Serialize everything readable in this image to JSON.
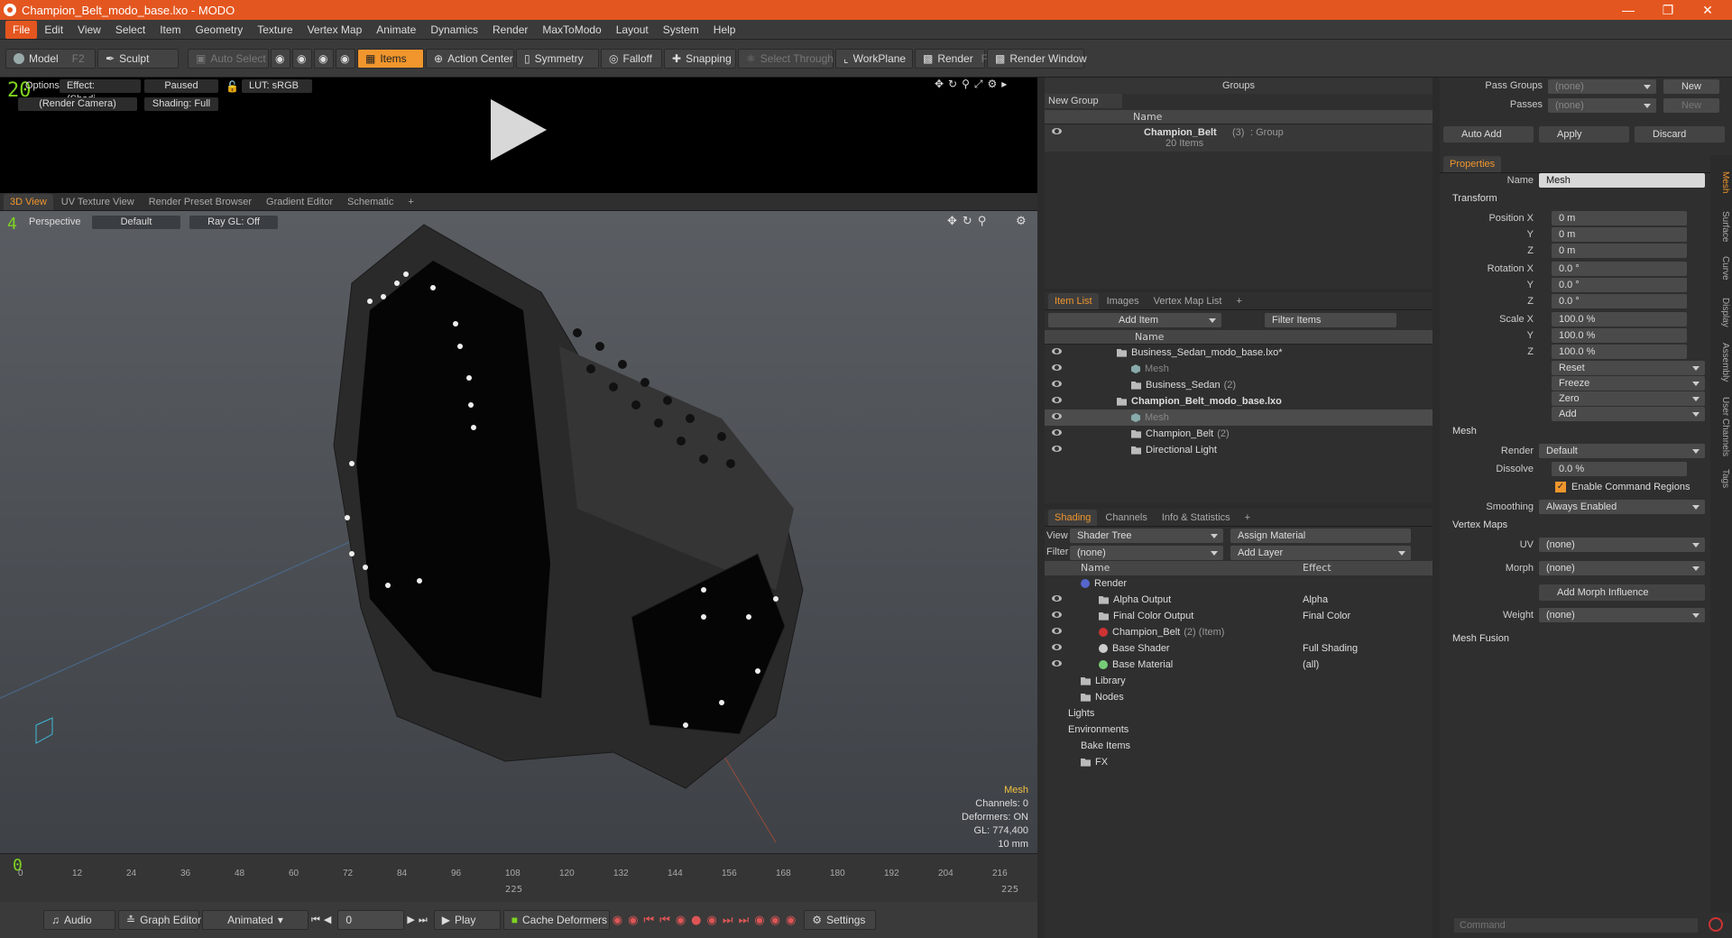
{
  "window": {
    "title": "Champion_Belt_modo_base.lxo - MODO"
  },
  "menus": [
    "File",
    "Edit",
    "View",
    "Select",
    "Item",
    "Geometry",
    "Texture",
    "Vertex Map",
    "Animate",
    "Dynamics",
    "Render",
    "MaxToModo",
    "Layout",
    "System",
    "Help"
  ],
  "toolbar": {
    "model": "Model",
    "model_key": "F2",
    "sculpt": "Sculpt",
    "auto_select": "Auto Select",
    "items": "Items",
    "action_center": "Action Center",
    "symmetry": "Symmetry",
    "falloff": "Falloff",
    "snapping": "Snapping",
    "select_through": "Select Through",
    "workplane": "WorkPlane",
    "render": "Render",
    "render_key": "F9",
    "render_window": "Render Window"
  },
  "preview": {
    "frame": "20",
    "options": "Options",
    "effect": "Effect: (Shadi...",
    "paused": "Paused",
    "lut": "LUT: sRGB",
    "camera": "(Render Camera)",
    "shading": "Shading: Full"
  },
  "view_tabs": [
    "3D View",
    "UV Texture View",
    "Render Preset Browser",
    "Gradient Editor",
    "Schematic",
    "+"
  ],
  "viewport": {
    "view_num": "4",
    "perspective": "Perspective",
    "default": "Default",
    "raygl": "Ray GL: Off",
    "info": {
      "type": "Mesh",
      "channels": "Channels: 0",
      "deformers": "Deformers: ON",
      "gl": "GL: 774,400",
      "scale": "10 mm"
    }
  },
  "timeline": {
    "frame": "0",
    "end": "225",
    "ticks": [
      "0",
      "12",
      "24",
      "36",
      "48",
      "60",
      "72",
      "84",
      "96",
      "108",
      "120",
      "132",
      "144",
      "156",
      "168",
      "180",
      "192",
      "204",
      "216"
    ]
  },
  "bottombar": {
    "audio": "Audio",
    "graph_editor": "Graph Editor",
    "animated": "Animated",
    "frame": "0",
    "play": "Play",
    "cache": "Cache Deformers",
    "settings": "Settings"
  },
  "groups": {
    "title": "Groups",
    "new_group": "New Group",
    "col_name": "Name",
    "group_name": "Champion_Belt",
    "group_count": "(3)",
    "group_type": ": Group",
    "group_items": "20 Items"
  },
  "itemlist": {
    "tabs": [
      "Item List",
      "Images",
      "Vertex Map List",
      "+"
    ],
    "add_item": "Add Item",
    "filter": "Filter Items",
    "col_name": "Name",
    "rows": [
      {
        "name": "Business_Sedan_modo_base.lxo*",
        "bold": false
      },
      {
        "name": "Mesh",
        "dim": true
      },
      {
        "name": "Business_Sedan",
        "count": "(2)"
      },
      {
        "name": "Champion_Belt_modo_base.lxo",
        "bold": true
      },
      {
        "name": "Mesh",
        "dim": true
      },
      {
        "name": "Champion_Belt",
        "count": "(2)"
      },
      {
        "name": "Directional Light"
      }
    ]
  },
  "shading": {
    "tabs": [
      "Shading",
      "Channels",
      "Info & Statistics",
      "+"
    ],
    "view_label": "View",
    "view": "Shader Tree",
    "assign": "Assign Material",
    "filter_label": "Filter",
    "filter": "(none)",
    "add_layer": "Add Layer",
    "col_name": "Name",
    "col_effect": "Effect",
    "rows": [
      {
        "name": "Render",
        "effect": ""
      },
      {
        "name": "Alpha Output",
        "effect": "Alpha"
      },
      {
        "name": "Final Color Output",
        "effect": "Final Color"
      },
      {
        "name": "Champion_Belt",
        "extra": "(2) (Item)",
        "effect": ""
      },
      {
        "name": "Base Shader",
        "effect": "Full Shading"
      },
      {
        "name": "Base Material",
        "effect": "(all)"
      },
      {
        "name": "Library",
        "effect": ""
      },
      {
        "name": "Nodes",
        "effect": ""
      },
      {
        "name": "Lights",
        "effect": ""
      },
      {
        "name": "Environments",
        "effect": ""
      },
      {
        "name": "Bake Items",
        "effect": ""
      },
      {
        "name": "FX",
        "effect": ""
      }
    ]
  },
  "passes": {
    "pass_groups": "Pass Groups",
    "passes": "Passes",
    "none": "(none)",
    "new": "New"
  },
  "actions": {
    "auto_add": "Auto Add",
    "apply": "Apply",
    "discard": "Discard"
  },
  "properties": {
    "tab": "Properties",
    "name_label": "Name",
    "name": "Mesh",
    "transform": "Transform",
    "pos_x": "Position X",
    "y": "Y",
    "z": "Z",
    "zero_m": "0 m",
    "rot_x": "Rotation X",
    "zero_deg": "0.0 °",
    "scale_x": "Scale X",
    "hundred": "100.0 %",
    "reset": "Reset",
    "freeze": "Freeze",
    "zero": "Zero",
    "add": "Add",
    "mesh": "Mesh",
    "render_label": "Render",
    "render": "Default",
    "dissolve_label": "Dissolve",
    "dissolve": "0.0 %",
    "cmd_regions": "Enable Command Regions",
    "smoothing_label": "Smoothing",
    "smoothing": "Always Enabled",
    "vmaps": "Vertex Maps",
    "uv_label": "UV",
    "morph_label": "Morph",
    "add_morph": "Add Morph Influence",
    "weight_label": "Weight",
    "mesh_fusion": "Mesh Fusion"
  },
  "vtabs": [
    "Mesh",
    "Surface",
    "Curve",
    "Display",
    "Assembly",
    "User Channels",
    "Tags"
  ],
  "command": {
    "placeholder": "Command"
  }
}
